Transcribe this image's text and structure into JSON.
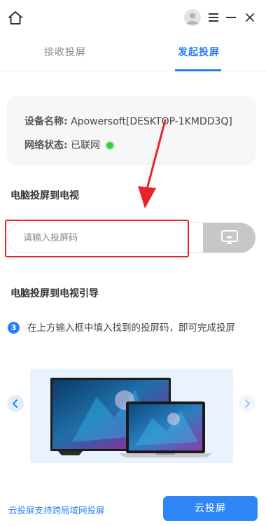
{
  "tabs": {
    "receive": "接收投屏",
    "start": "发起投屏"
  },
  "device": {
    "name_key": "设备名称:",
    "name_value": "Apowersoft[DESKTOP-1KMDD3Q]",
    "status_key": "网络状态:",
    "status_value": "已联网",
    "status_color": "#2fcf48"
  },
  "section_cast": {
    "title": "电脑投屏到电视"
  },
  "code_input": {
    "placeholder": "请输入投屏码",
    "value": ""
  },
  "section_guide": {
    "title": "电脑投屏到电视引导"
  },
  "guide_step": {
    "number": "3",
    "text": "在上方输入框中填入找到的投屏码，即可完成投屏"
  },
  "footer": {
    "link": "云投屏支持跨局域网投屏",
    "button": "云投屏"
  },
  "colors": {
    "accent": "#2a7df5",
    "highlight": "#e8232a"
  }
}
